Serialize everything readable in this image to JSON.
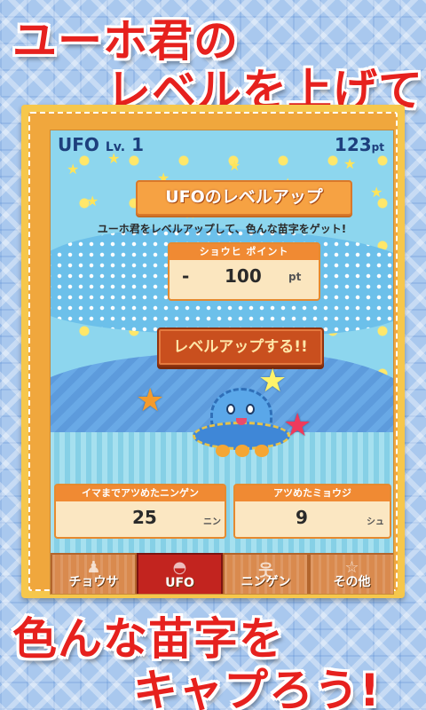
{
  "headline": {
    "line1": "ユーホ君の",
    "line2": "レベルを上げて"
  },
  "footer": {
    "line1": "色んな苗字を",
    "line2": "キャプろう!"
  },
  "hud": {
    "name": "UFO",
    "level_label": "Lv.",
    "level": "1",
    "points": "123",
    "points_unit": "pt"
  },
  "panel": {
    "title": "UFOのレベルアップ",
    "subtitle": "ユーホ君をレベルアップして、色んな苗字をゲット!",
    "cost": {
      "label": "ショウヒ ポイント",
      "sign": "-",
      "value": "100",
      "unit": "pt"
    },
    "button_label": "レベルアップする!!"
  },
  "stats": {
    "people": {
      "label": "イマまでアツめたニンゲン",
      "value": "25",
      "unit": "ニン"
    },
    "names": {
      "label": "アツめたミョウジ",
      "value": "9",
      "unit": "シュ"
    }
  },
  "tabs": [
    {
      "label": "チョウサ",
      "icon": "person-icon",
      "active": false
    },
    {
      "label": "UFO",
      "icon": "ufo-icon",
      "active": true
    },
    {
      "label": "ニンゲン",
      "icon": "human-icon",
      "active": false
    },
    {
      "label": "その他",
      "icon": "star-icon",
      "active": false
    }
  ],
  "colors": {
    "accent": "#e6211e",
    "tab_active": "#c2241f",
    "frame": "#f6c74c"
  }
}
